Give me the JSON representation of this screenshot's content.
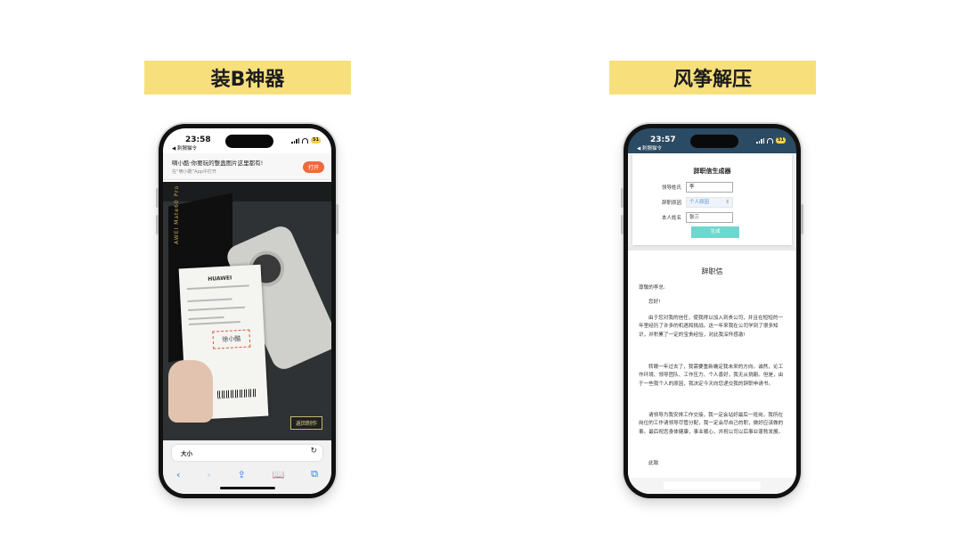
{
  "left_panel": {
    "banner": "装B神器",
    "status": {
      "time": "23:58",
      "back_label": "◀ 刺猬猫令",
      "battery": "51"
    },
    "ad": {
      "title": "嘀小酷·你要玩的整蛊图片这里都有!",
      "subtitle": "在“嘀小酷”App中打开",
      "button": "打开"
    },
    "photo": {
      "brand": "HUAWEI",
      "box_text": "AWEI Mate60 Pro",
      "signature": "徐小酷",
      "back_button": "返回制作"
    },
    "browser": {
      "address": "大小",
      "reload_icon": "↻",
      "toolbar": [
        "‹",
        "›",
        "⇪",
        "📖",
        "⧉"
      ]
    }
  },
  "right_panel": {
    "banner": "风筝解压",
    "status": {
      "time": "23:57",
      "back_label": "◀ 刺猬猫令",
      "battery": "51"
    },
    "form": {
      "title": "辞职信生成器",
      "rows": [
        {
          "label": "领导姓氏",
          "value": "李"
        },
        {
          "label": "辞职原因",
          "value": "个人原因",
          "arrow": "⇕"
        },
        {
          "label": "本人姓名",
          "value": "张三"
        }
      ],
      "button": "生成"
    },
    "letter": {
      "title": "辞职信",
      "paragraphs": [
        "尊敬的李总:",
        "您好!",
        "由于您对我的信任，使我得以加入到贵公司，并且在短短的一年里经历了许多的机遇和挑战。这一年来我在公司学到了很多知识，并积累了一定的宝贵经验，对此我深怀感激!",
        "转眼一年过去了，我需要重新确定我未来的方向。诚然，论工作环境、领导团队、工作压力、个人喜好，我无从挑剔。但是，由于一些我个人的原因，我决定今天向您递交我的辞职申请书。",
        "请领导为我安排工作交接，我一定会站好最后一班岗，我所在岗位的工作请领导尽管分配，我一定会尽自己的职，做好应该做的事。最后祝您身体健康，事业顺心，并祝公司以后事业蓬勃发展。",
        "此致"
      ]
    }
  }
}
